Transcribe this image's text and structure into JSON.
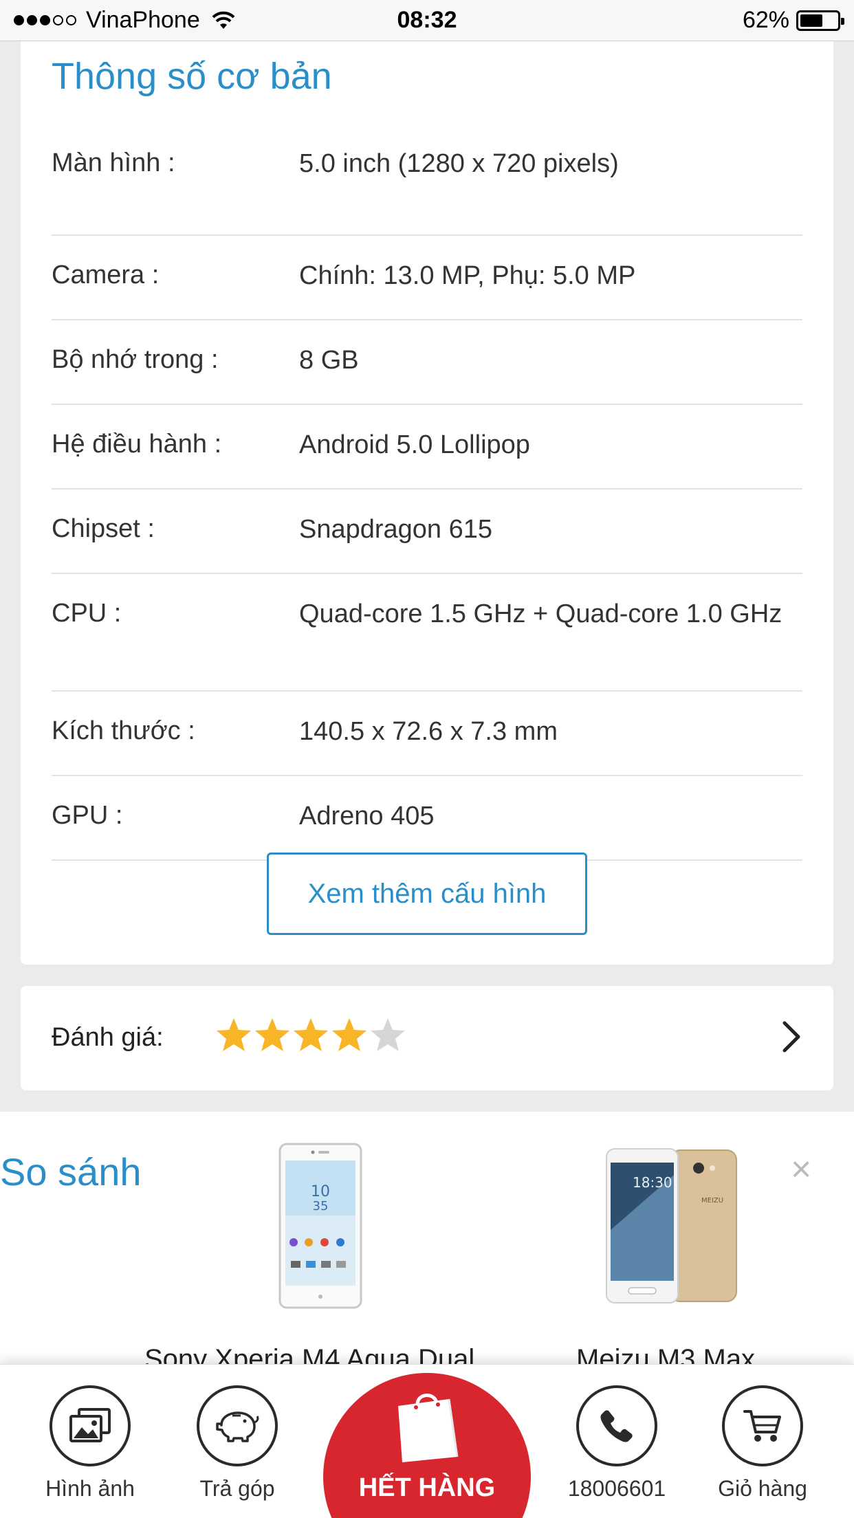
{
  "status_bar": {
    "carrier": "VinaPhone",
    "time": "08:32",
    "battery": "62%",
    "battery_level": 0.62,
    "signal_bars": 3
  },
  "specs": {
    "title": "Thông số cơ bản",
    "rows": [
      {
        "label": "Màn hình :",
        "value": "5.0 inch (1280 x 720 pixels)"
      },
      {
        "label": "Camera :",
        "value": "Chính: 13.0 MP, Phụ: 5.0 MP"
      },
      {
        "label": "Bộ nhớ trong :",
        "value": "8 GB"
      },
      {
        "label": "Hệ điều hành :",
        "value": "Android 5.0 Lollipop"
      },
      {
        "label": "Chipset :",
        "value": "Snapdragon 615"
      },
      {
        "label": "CPU :",
        "value": "Quad-core 1.5 GHz + Quad-core 1.0 GHz"
      },
      {
        "label": "Kích thước :",
        "value": "140.5 x 72.6 x 7.3 mm"
      },
      {
        "label": "GPU :",
        "value": "Adreno 405"
      }
    ],
    "more_button": "Xem thêm cấu hình"
  },
  "rating": {
    "label": "Đánh giá:",
    "stars": 4,
    "max_stars": 5
  },
  "compare": {
    "title": "So sánh",
    "products": [
      {
        "name": "Sony Xperia M4 Aqua Dual"
      },
      {
        "name": "Meizu M3 Max"
      }
    ]
  },
  "bottom_bar": {
    "images_label": "Hình ảnh",
    "installment_label": "Trả góp",
    "soldout_label": "HẾT HÀNG",
    "phone_label": "18006601",
    "cart_label": "Giỏ hàng"
  },
  "colors": {
    "accent": "#2a8fc9",
    "star": "#f7b527",
    "star_empty": "#d6d6d6",
    "soldout": "#d8262e"
  }
}
